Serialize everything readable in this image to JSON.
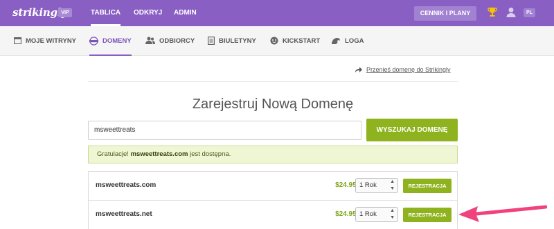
{
  "topbar": {
    "logo": "strikingly",
    "vip_badge": "VIP",
    "nav": [
      {
        "label": "TABLICA",
        "active": true
      },
      {
        "label": "ODKRYJ",
        "active": false
      },
      {
        "label": "ADMIN",
        "active": false
      }
    ],
    "plans_button": "CENNIK I PLANY",
    "lang_badge": "PL"
  },
  "subnav": [
    {
      "label": "MOJE WITRYNY",
      "icon": "site-icon"
    },
    {
      "label": "DOMENY",
      "icon": "www-icon",
      "active": true
    },
    {
      "label": "ODBIORCY",
      "icon": "audience-icon"
    },
    {
      "label": "BIULETYNY",
      "icon": "newsletter-icon"
    },
    {
      "label": "KICKSTART",
      "icon": "kickstart-icon"
    },
    {
      "label": "LOGA",
      "icon": "logo-icon"
    }
  ],
  "transfer_link": "Przenieś domenę do Strikingly",
  "title": "Zarejestruj Nową Domenę",
  "search": {
    "value": "msweettreats",
    "button": "WYSZUKAJ DOMENĘ"
  },
  "success": {
    "prefix": "Gratulacje!",
    "domain": "msweettreats.com",
    "suffix": "jest dostępna."
  },
  "results": [
    {
      "domain": "msweettreats.com",
      "price": "$24.95/rok",
      "period": "1 Rok",
      "button": "REJESTRACJA"
    },
    {
      "domain": "msweettreats.net",
      "price": "$24.95/rok",
      "period": "1 Rok",
      "button": "REJESTRACJA"
    }
  ],
  "colors": {
    "brand_purple": "#8a5fc4",
    "accent_green": "#8fb31f",
    "arrow_pink": "#f0427c"
  }
}
